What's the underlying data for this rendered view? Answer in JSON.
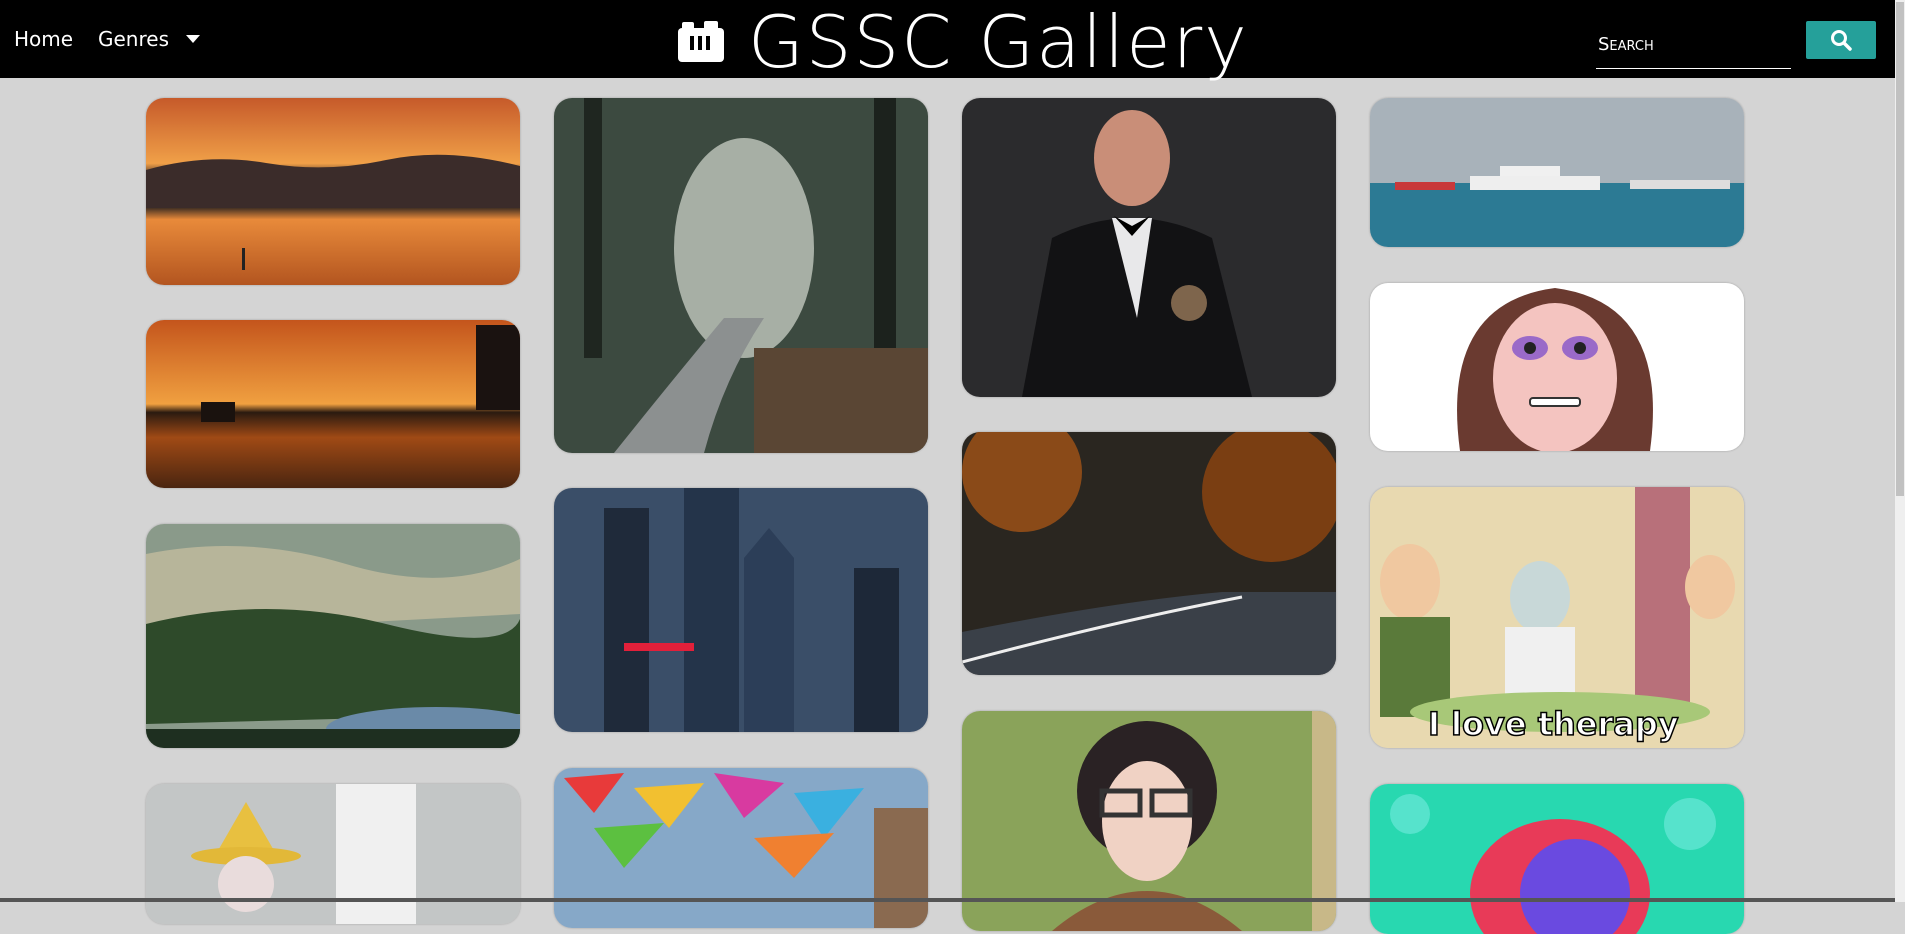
{
  "nav": {
    "home_label": "Home",
    "genres_label": "Genres"
  },
  "brand": {
    "title": "GSSC Gallery",
    "icon": "camera-icon"
  },
  "search": {
    "placeholder": "Search",
    "button_icon": "search-icon"
  },
  "colors": {
    "navbar": "#000000",
    "accent": "#25a09a",
    "page_background": "#d4d4d4"
  },
  "gallery": {
    "caption": "I love therapy"
  }
}
